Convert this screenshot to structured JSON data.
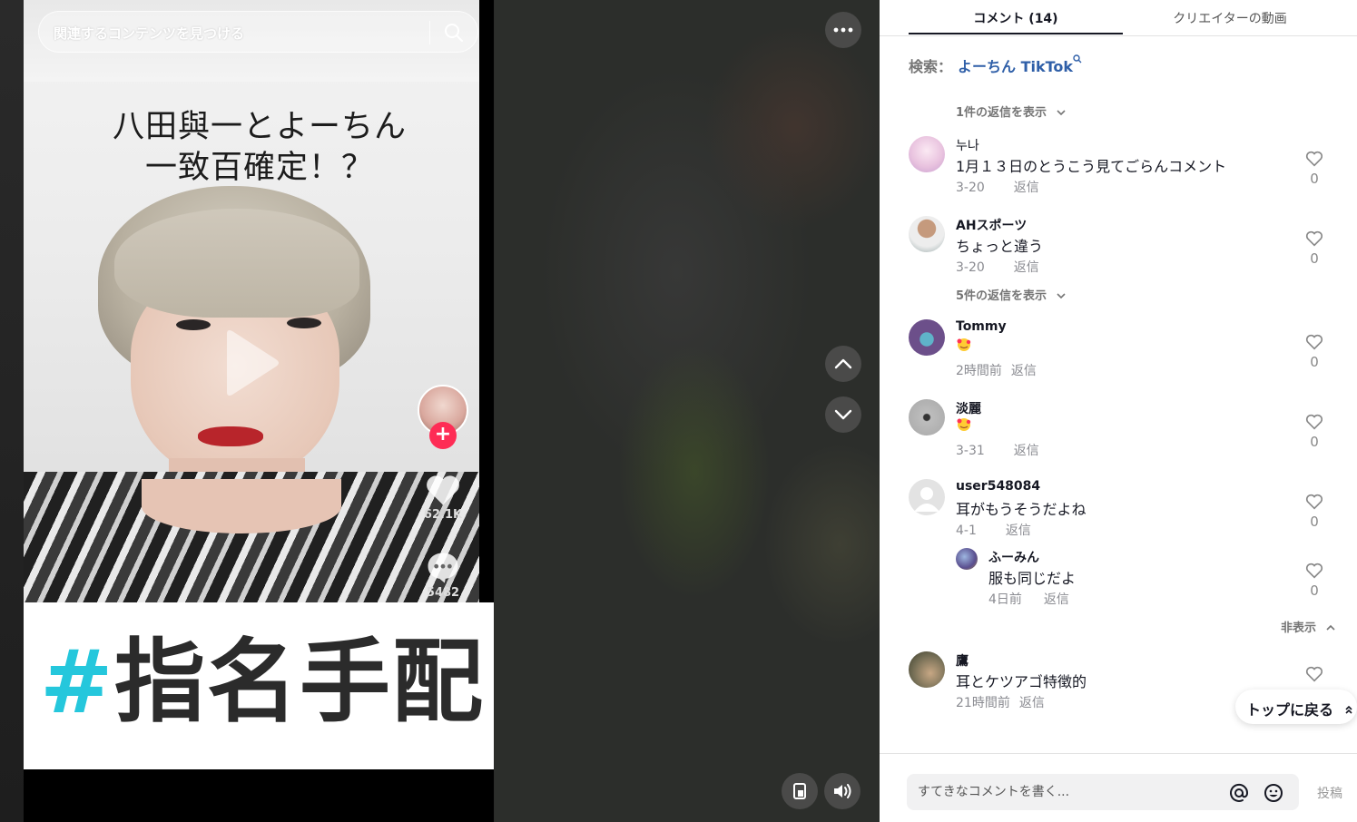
{
  "video": {
    "search_placeholder": "関連するコンテンツを見つける",
    "caption_line1": "八田與一とよーちん",
    "caption_line2": "一致百確定！？",
    "banner_hash": "#",
    "banner_text": "指名手配",
    "like_count": "62.1K",
    "comment_count": "5482"
  },
  "tabs": {
    "comments": "コメント (14)",
    "creator_videos": "クリエイターの動画"
  },
  "search": {
    "label": "検索：",
    "query": "よーちん TikTok"
  },
  "view_replies_1": "1件の返信を表示",
  "view_replies_5": "5件の返信を表示",
  "hide_label": "非表示",
  "back_to_top": "トップに戻る",
  "reply_label": "返信",
  "comments": [
    {
      "user": "누나",
      "text": "1月１３日のとうこう見てごらんコメント",
      "date": "3-20",
      "likes": "0"
    },
    {
      "user": "AHスポーツ",
      "text": "ちょっと違う",
      "date": "3-20",
      "likes": "0"
    },
    {
      "user": "Tommy",
      "text": "",
      "date": "2時間前",
      "likes": "0"
    },
    {
      "user": "淡麗",
      "text": "",
      "date": "3-31",
      "likes": "0"
    },
    {
      "user": "user548084",
      "text": "耳がもうそうだよね",
      "date": "4-1",
      "likes": "0"
    },
    {
      "user": "ふーみん",
      "text": "服も同じだよ",
      "date": "4日前",
      "likes": "0"
    },
    {
      "user": "鷹",
      "text": "耳とケツアゴ特徴的",
      "date": "21時間前",
      "likes": ""
    }
  ],
  "comment_bar": {
    "placeholder": "すてきなコメントを書く...",
    "post_label": "投稿"
  },
  "colors": {
    "accent_red": "#fe2c55",
    "link_blue": "#2f5fa8",
    "banner_cyan": "#25c7dc"
  }
}
